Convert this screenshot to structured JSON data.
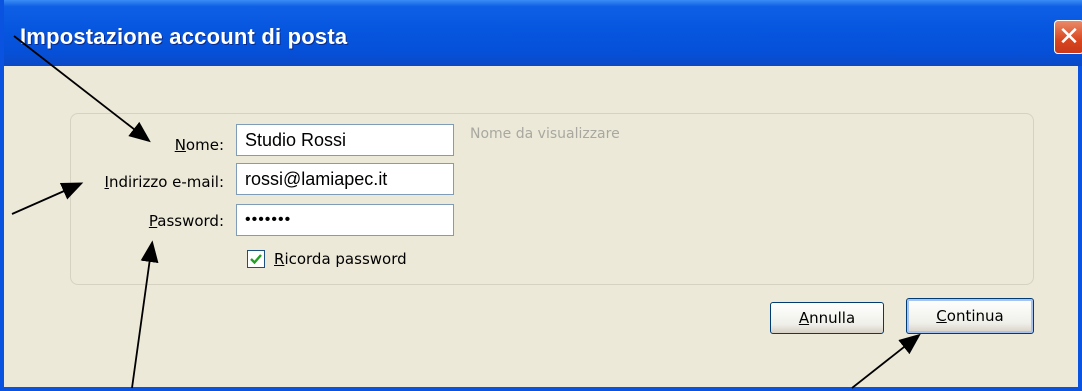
{
  "window": {
    "title": "Impostazione account di posta",
    "close_glyph": "✕"
  },
  "form": {
    "name_label": "Nome:",
    "name_value": "Studio Rossi",
    "name_hint": "Nome da visualizzare",
    "email_label": "Indirizzo e-mail:",
    "email_value": "rossi@lamiapec.it",
    "password_label": "Password:",
    "password_value": "•••••••",
    "remember_label": "Ricorda password",
    "remember_checked": true
  },
  "buttons": {
    "cancel": "Annulla",
    "continue": "Continua"
  },
  "icons": {
    "checkmark": "checkmark-icon",
    "close": "close-icon",
    "annotation": "arrow-icon"
  },
  "colors": {
    "titlebar": "#0757E0",
    "window_bg": "#ECE9D8",
    "close": "#D8461E",
    "check": "#21A121"
  }
}
